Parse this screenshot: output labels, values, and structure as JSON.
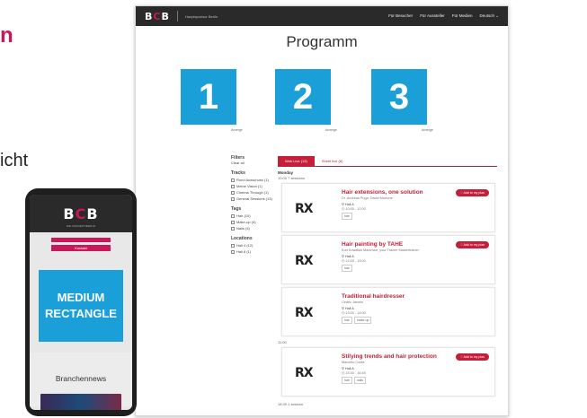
{
  "left_text": {
    "heading": "n",
    "label": "icht"
  },
  "desktop": {
    "logo": {
      "b1": "B",
      "o": "C",
      "b2": "B"
    },
    "tagline": "Hauptsponsor Berlin",
    "nav": [
      "Für Besucher",
      "Für Aussteller",
      "Für Medien",
      "Deutsch ⌄"
    ],
    "page_title": "Programm",
    "banners": [
      {
        "number": "1",
        "caption": "Anzeige"
      },
      {
        "number": "2",
        "caption": "Anzeige"
      },
      {
        "number": "3",
        "caption": "Anzeige"
      }
    ],
    "filters": {
      "title": "Filters",
      "clear": "Clear all",
      "tracks_title": "Tracks",
      "tracks": [
        "Rund Ausschuss (1)",
        "Meine Vision (1)",
        "Cinema Through (1)",
        "General Sessions (13)"
      ],
      "tags_title": "Tags",
      "tags": [
        "Hair (10)",
        "Make-up (4)",
        "Nails (4)"
      ],
      "locations_title": "Locations",
      "locations": [
        "Hall 4 (12)",
        "Hall 8 (1)"
      ]
    },
    "tabs": {
      "active": "Web Live (13)",
      "other": "Sheet live (8)"
    },
    "day": "Monday",
    "time_first": "10:00  7 sessions",
    "slot_time": "11:00",
    "more_label": "18:30  1 session",
    "plan_button": "Add to my plan",
    "logo_text": "RX",
    "sessions": [
      {
        "title": "Hair extensions, one solution",
        "speakers": "Dr. Andreas Puga, David Marrone",
        "location": "Hall A",
        "time": "10:00 - 12:00",
        "tags": [
          "hair"
        ]
      },
      {
        "title": "Hair painting by TAHE",
        "speakers": "Kurt Kowalski Markmarr, your Trainer Mastertrainer",
        "location": "Hall A",
        "time": "12:00 - 13:00",
        "tags": [
          "hair"
        ]
      },
      {
        "title": "Traditional hairdresser",
        "speakers": "Cedric Jasmin",
        "location": "Hall A",
        "time": "13:00 - 14:00",
        "tags": [
          "hair",
          "make-up"
        ]
      },
      {
        "title": "Stilying trends and hair protection",
        "speakers": "Marcello Costa",
        "location": "Hall A",
        "time": "15:30 - 16:45",
        "tags": [
          "hair",
          "nails"
        ]
      }
    ]
  },
  "phone": {
    "logo": {
      "b1": "B",
      "o": "C",
      "b2": "B"
    },
    "subtitle": "DIE CONCEPT BERLIN",
    "button": "Kontakt",
    "ad_line1": "MEDIUM",
    "ad_line2": "RECTANGLE",
    "news": "Branchennews"
  }
}
